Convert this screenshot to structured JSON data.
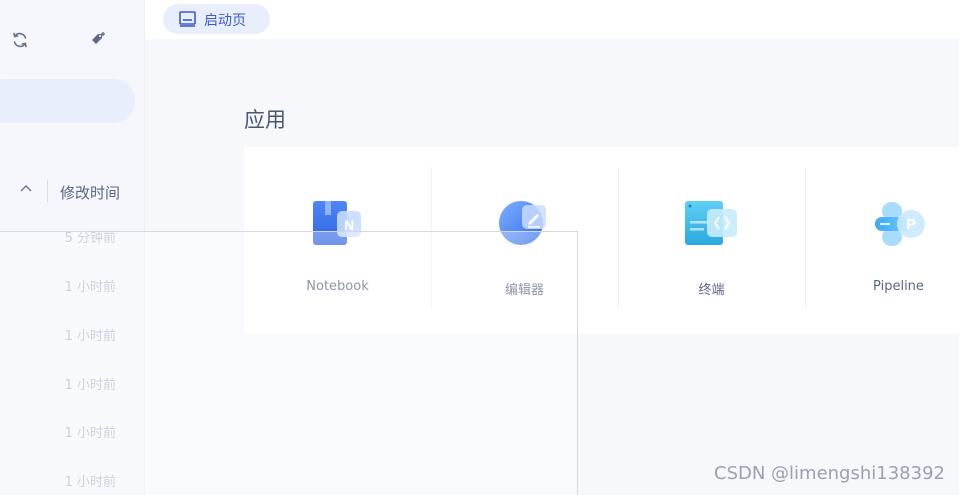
{
  "sidebar": {
    "refresh_icon": "refresh-icon",
    "add_tag_icon": "tag-plus-icon",
    "sort": {
      "label": "修改时间",
      "chevron_icon": "chevron-up-icon"
    },
    "files": [
      {
        "time": "5 分钟前"
      },
      {
        "time": "1 小时前"
      },
      {
        "time": "1 小时前"
      },
      {
        "time": "1 小时前"
      },
      {
        "time": "1 小时前"
      },
      {
        "time": "1 小时前"
      }
    ]
  },
  "tabs": [
    {
      "label": "启动页",
      "icon": "launcher-icon"
    }
  ],
  "main": {
    "section_title": "应用",
    "apps": [
      {
        "label": "Notebook",
        "icon": "notebook-icon"
      },
      {
        "label": "编辑器",
        "icon": "editor-icon"
      },
      {
        "label": "终端",
        "icon": "terminal-icon"
      },
      {
        "label": "Pipeline",
        "icon": "pipeline-icon"
      }
    ]
  },
  "watermark": "CSDN @limengshi138392",
  "colors": {
    "accent": "#3a5ccc",
    "sidebar_bg": "#f5f7fc",
    "pill_bg": "#e8eefb",
    "card_bg": "#ffffff",
    "muted_text": "#b6bccb"
  }
}
